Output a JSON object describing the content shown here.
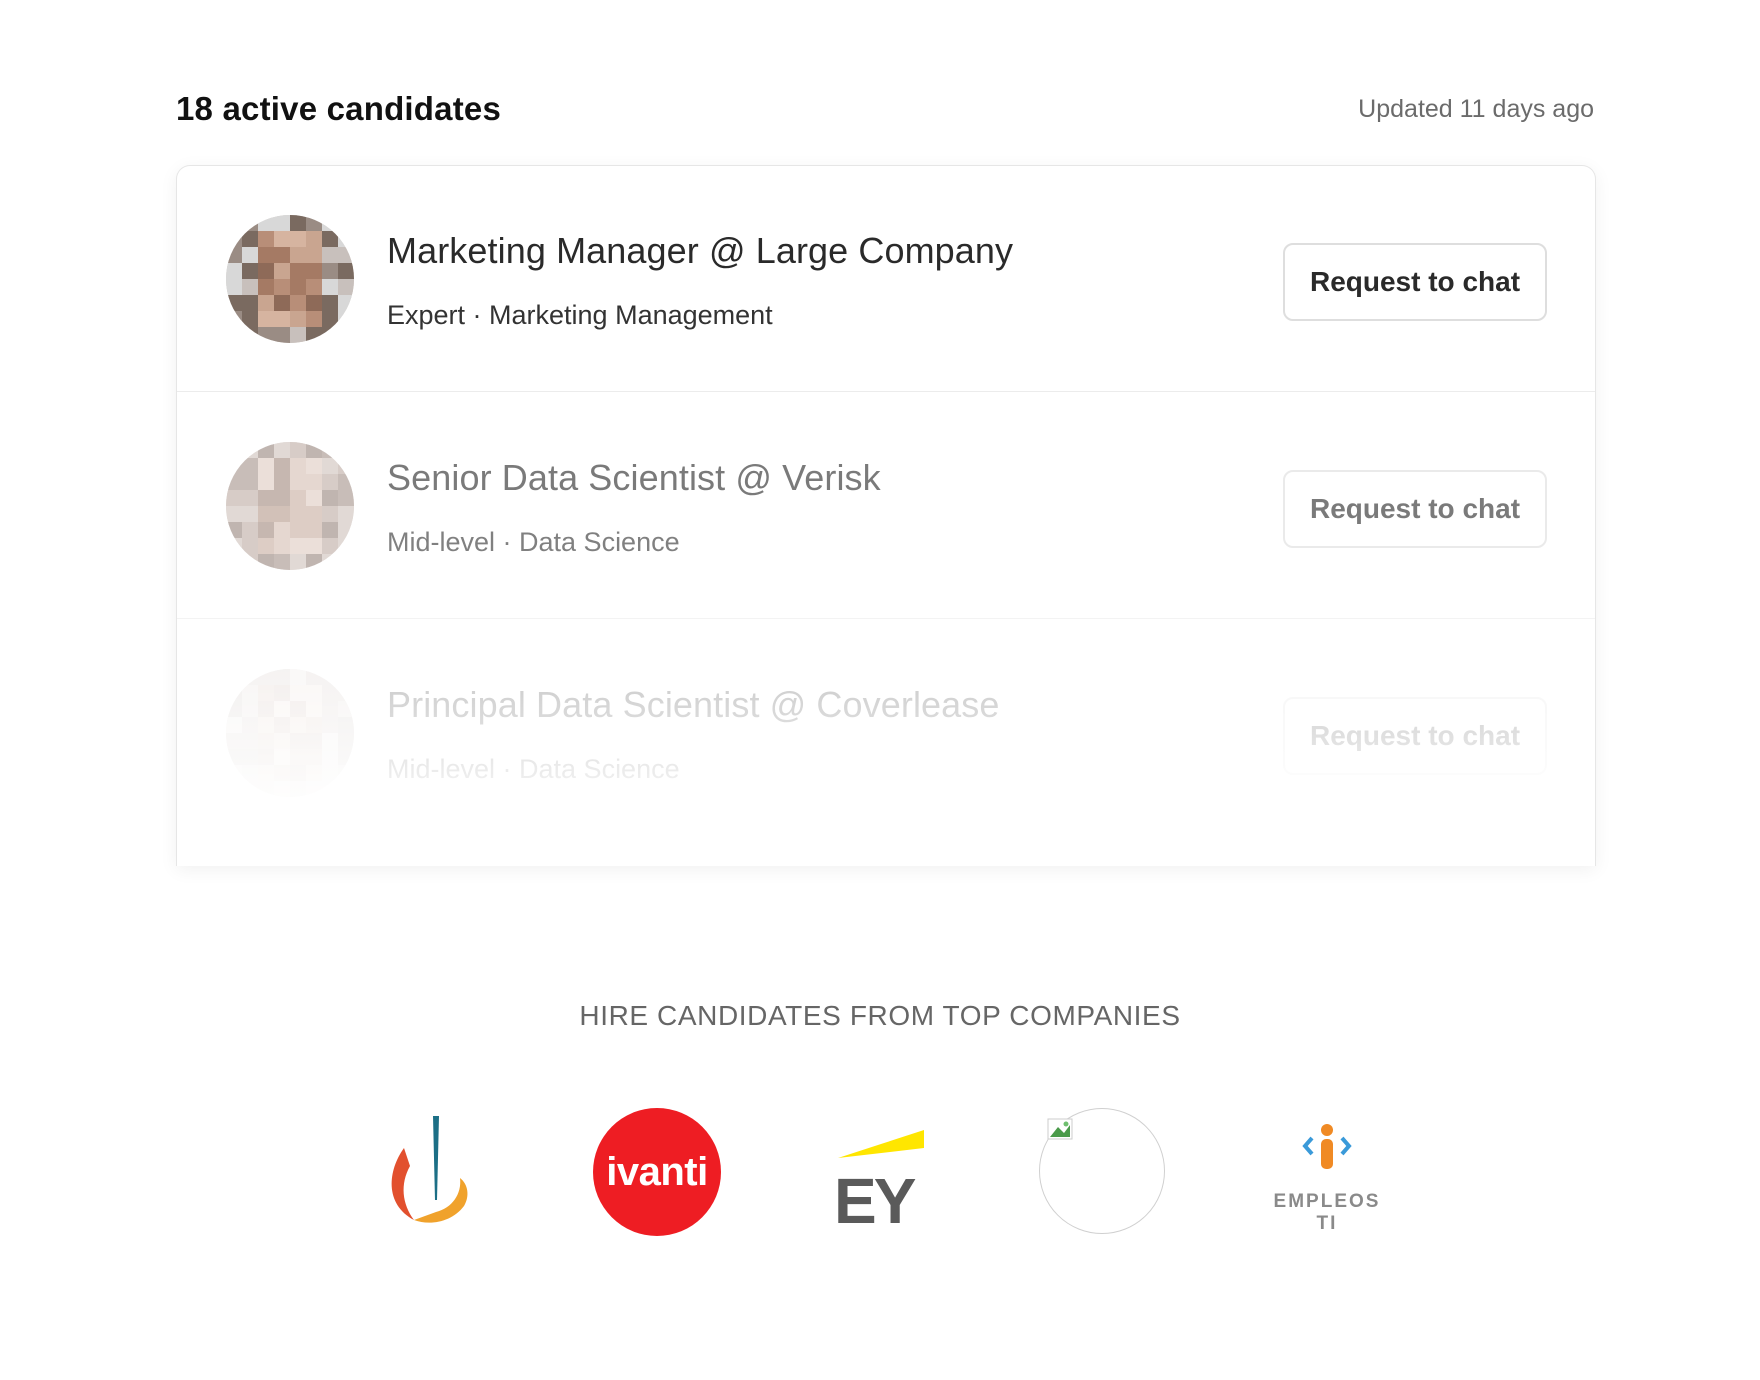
{
  "header": {
    "count_title": "18 active candidates",
    "updated": "Updated 11 days ago"
  },
  "candidates": [
    {
      "title": "Marketing Manager @ Large Company",
      "meta": "Expert · Marketing Management",
      "button": "Request to chat",
      "avatar_icon": "avatar-pixelated"
    },
    {
      "title": "Senior Data Scientist @ Verisk",
      "meta": "Mid-level · Data Science",
      "button": "Request to chat",
      "avatar_icon": "avatar-pixelated"
    },
    {
      "title": "Principal Data Scientist @ Coverlease",
      "meta": "Mid-level · Data Science",
      "button": "Request to chat",
      "avatar_icon": "avatar-pixelated"
    }
  ],
  "companies": {
    "title": "HIRE CANDIDATES FROM TOP COMPANIES",
    "logos": [
      {
        "name": "flame-logo"
      },
      {
        "name": "ivanti-logo",
        "text": "ivanti"
      },
      {
        "name": "ey-logo",
        "text": "EY"
      },
      {
        "name": "broken-image-logo"
      },
      {
        "name": "empleosti-logo",
        "text": "EMPLEOS TI"
      }
    ]
  },
  "colors": {
    "ivanti_red": "#ee1d23",
    "ey_yellow": "#ffe600",
    "ey_gray": "#5a5a5a"
  }
}
